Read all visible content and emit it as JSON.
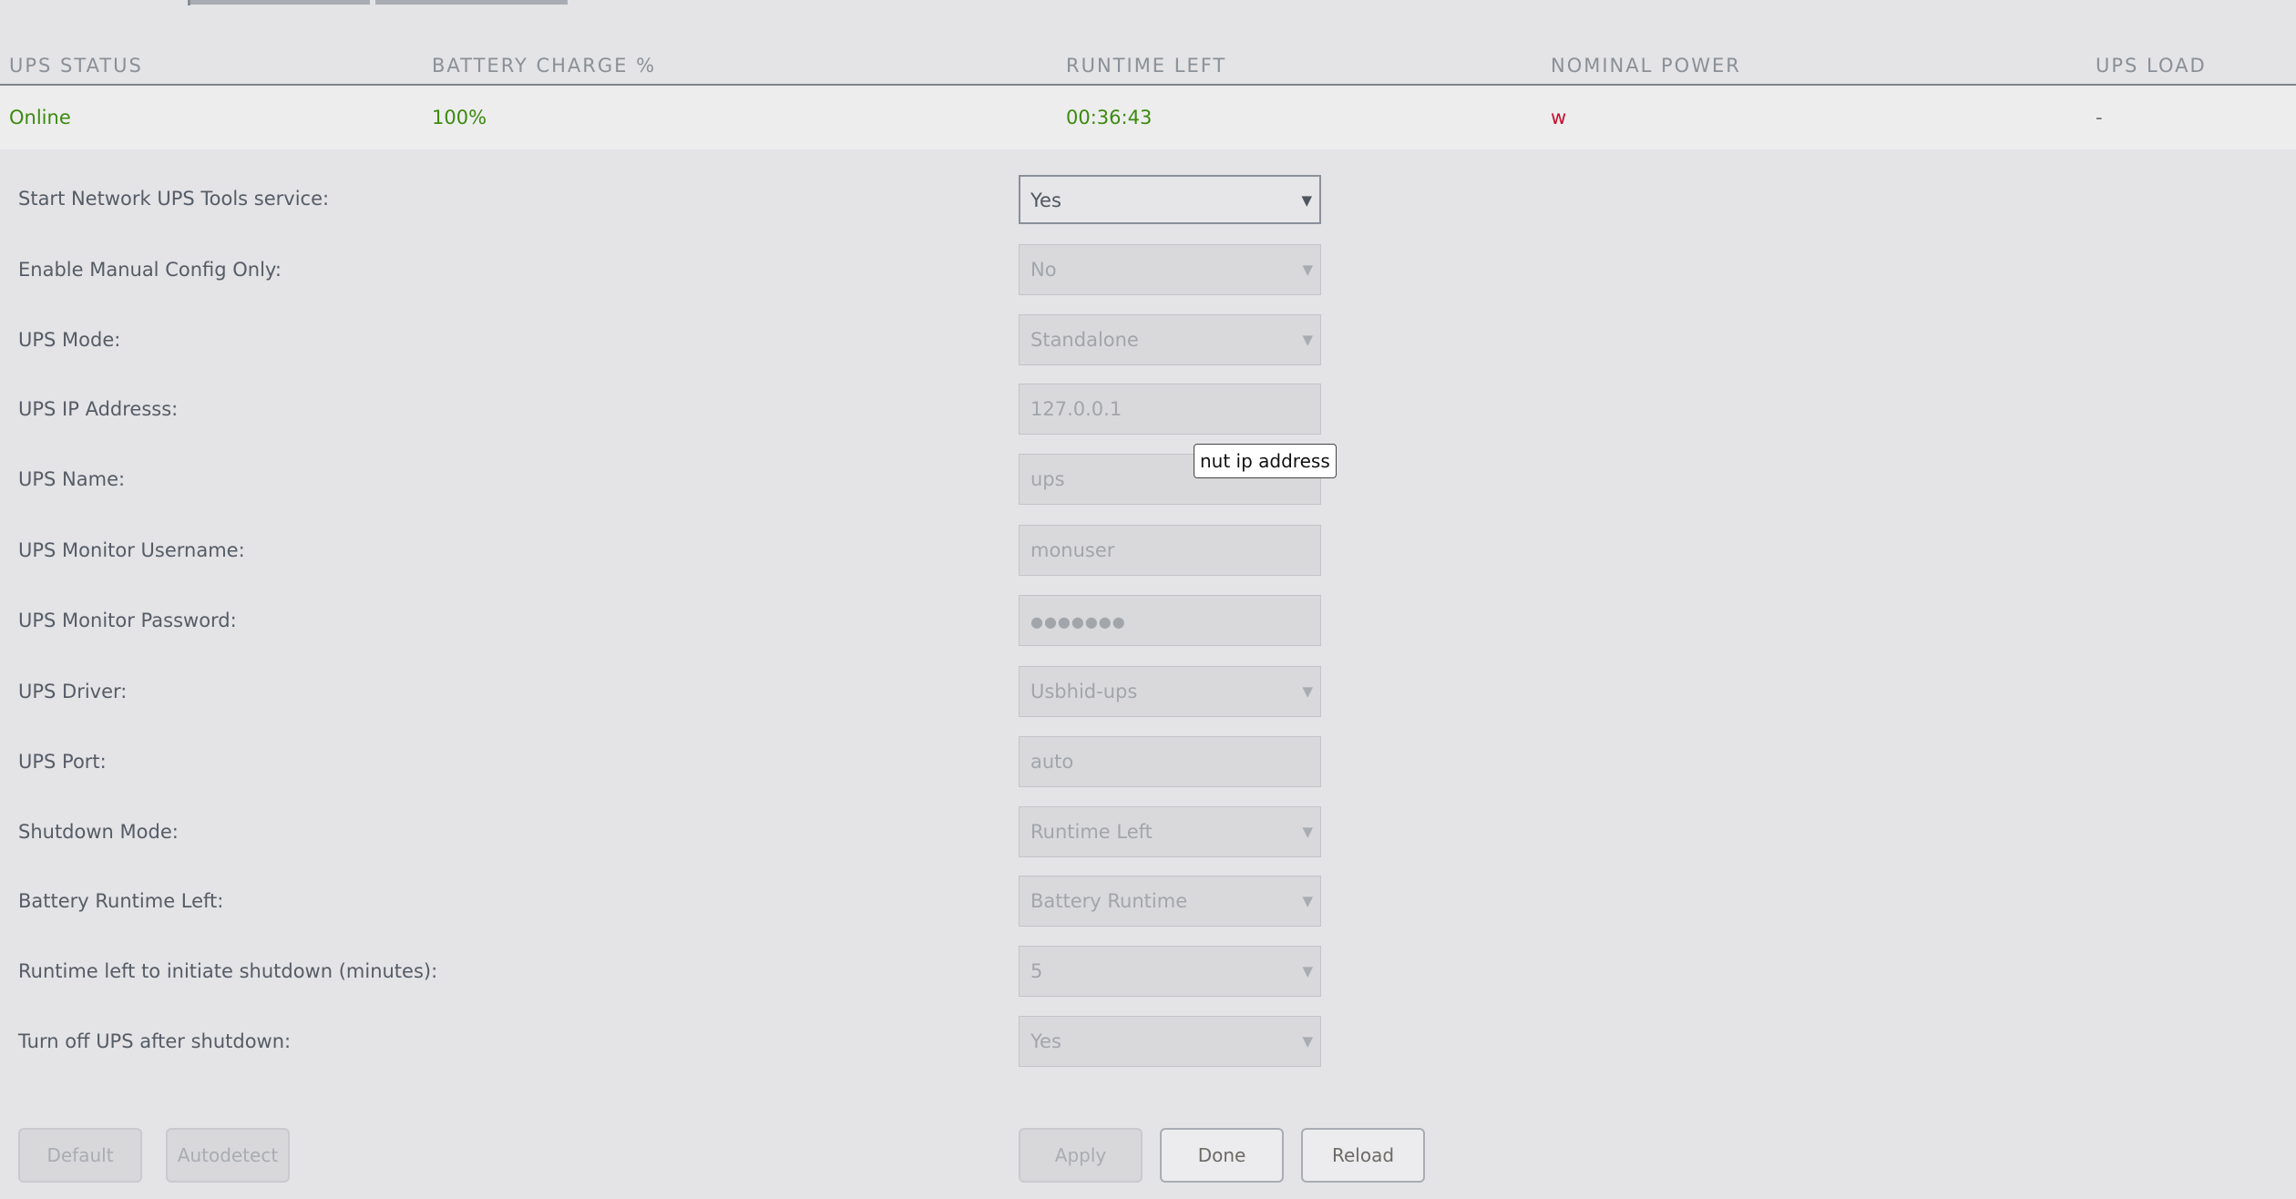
{
  "status_table": {
    "headers": [
      "UPS STATUS",
      "BATTERY CHARGE %",
      "RUNTIME LEFT",
      "NOMINAL POWER",
      "UPS LOAD"
    ],
    "row": {
      "ups_status": "Online",
      "battery_charge": "100%",
      "runtime_left": "00:36:43",
      "nominal_power": "w",
      "ups_load": "-"
    },
    "colors": {
      "ok": "#3c8a0e",
      "alert": "#c8102e"
    }
  },
  "form": {
    "start_service": {
      "label": "Start Network UPS Tools service:",
      "value": "Yes"
    },
    "manual_config": {
      "label": "Enable Manual Config Only:",
      "value": "No"
    },
    "ups_mode": {
      "label": "UPS Mode:",
      "value": "Standalone"
    },
    "ip_address": {
      "label": "UPS IP Addresss:",
      "value": "127.0.0.1"
    },
    "ups_name": {
      "label": "UPS Name:",
      "value": "ups"
    },
    "monitor_username": {
      "label": "UPS Monitor Username:",
      "value": "monuser"
    },
    "monitor_password": {
      "label": "UPS Monitor Password:",
      "value": "●●●●●●●"
    },
    "ups_driver": {
      "label": "UPS Driver:",
      "value": "Usbhid-ups"
    },
    "ups_port": {
      "label": "UPS Port:",
      "value": "auto"
    },
    "shutdown_mode": {
      "label": "Shutdown Mode:",
      "value": "Runtime Left"
    },
    "battery_runtime": {
      "label": "Battery Runtime Left:",
      "value": "Battery Runtime"
    },
    "runtime_minutes": {
      "label": "Runtime left to initiate shutdown (minutes):",
      "value": "5"
    },
    "turn_off_ups": {
      "label": "Turn off UPS after shutdown:",
      "value": "Yes"
    },
    "dropdown_arrow": "▼"
  },
  "tooltip": {
    "text": "nut ip address"
  },
  "buttons": {
    "default": "Default",
    "autodetect": "Autodetect",
    "apply": "Apply",
    "done": "Done",
    "reload": "Reload"
  }
}
